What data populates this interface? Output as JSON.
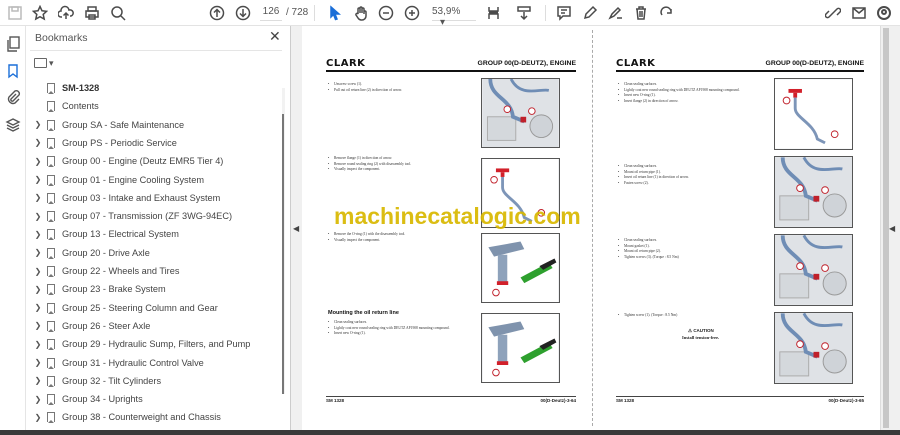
{
  "toolbar": {
    "page_current": "126",
    "page_total": "/ 728",
    "zoom": "53,9%"
  },
  "bookmarks": {
    "title": "Bookmarks",
    "close": "✕",
    "items": [
      {
        "label": "SM-1328",
        "bold": true,
        "expandable": false
      },
      {
        "label": "Contents",
        "expandable": false
      },
      {
        "label": "Group SA - Safe Maintenance",
        "expandable": true
      },
      {
        "label": "Group PS - Periodic Service",
        "expandable": true
      },
      {
        "label": "Group 00 - Engine (Deutz EMR5 Tier 4)",
        "expandable": true
      },
      {
        "label": "Group 01 - Engine Cooling System",
        "expandable": true
      },
      {
        "label": "Group 03 - Intake and Exhaust System",
        "expandable": true
      },
      {
        "label": "Group 07 - Transmission (ZF 3WG-94EC)",
        "expandable": true
      },
      {
        "label": "Group 13 - Electrical System",
        "expandable": true
      },
      {
        "label": "Group 20 - Drive Axle",
        "expandable": true
      },
      {
        "label": "Group 22 - Wheels and Tires",
        "expandable": true
      },
      {
        "label": "Group 23 - Brake System",
        "expandable": true
      },
      {
        "label": "Group 25 - Steering Column and Gear",
        "expandable": true
      },
      {
        "label": "Group 26 - Steer Axle",
        "expandable": true
      },
      {
        "label": "Group 29 - Hydraulic Sump, Filters, and Pump",
        "expandable": true
      },
      {
        "label": "Group 31 - Hydraulic Control Valve",
        "expandable": true
      },
      {
        "label": "Group 32 - Tilt Cylinders",
        "expandable": true
      },
      {
        "label": "Group 34 - Uprights",
        "expandable": true
      },
      {
        "label": "Group 38 - Counterweight and Chassis",
        "expandable": true
      }
    ]
  },
  "watermark": "machinecatalogic.com",
  "left_page": {
    "logo": "CLARK",
    "group": "GROUP 00(D-DEUTZ), ENGINE",
    "steps": [
      [
        "Unscrew screw (1).",
        "Pull out oil return line (2) in direction of arrow."
      ],
      [
        "Remove flange (1) in direction of arrow.",
        "Remove round sealing ring (2) with disassembly tool.",
        "Visually inspect the component."
      ],
      [
        "Remove the O-ring (1) with the disassembly tool.",
        "Visually inspect the component."
      ],
      [
        "Clean sealing surfaces.",
        "Lightly coat new round sealing ring with DEUTZ AP1908 mounting compound.",
        "Insert new O-ring (1)."
      ]
    ],
    "subheading": "Mounting the oil return line",
    "footer_left": "SM 1328",
    "footer_right": "00(D-Deutz)-3-64"
  },
  "right_page": {
    "logo": "CLARK",
    "group": "GROUP 00(D-DEUTZ), ENGINE",
    "steps": [
      [
        "Clean sealing surfaces.",
        "Lightly coat new round sealing ring with DEUTZ AP1908 mounting compound.",
        "Insert new O-ring (1).",
        "Insert flange (2) in direction of arrow."
      ],
      [
        "Clean sealing surfaces.",
        "Mount oil return pipe (1).",
        "Insert oil return line (1) in direction of arrow.",
        "Fasten screw (2)."
      ],
      [
        "Clean sealing surfaces.",
        "Mount gasket (1).",
        "Mount oil return pipe (2).",
        "Tighten screws (3). (Torque : 8.5 Nm)"
      ],
      [
        "Tighten screw (1). (Torque : 8.5 Nm)"
      ]
    ],
    "caution_title": "CAUTION",
    "caution_text": "Install tension-free.",
    "footer_left": "SM 1328",
    "footer_right": "00(D-Deutz)-3-65"
  }
}
